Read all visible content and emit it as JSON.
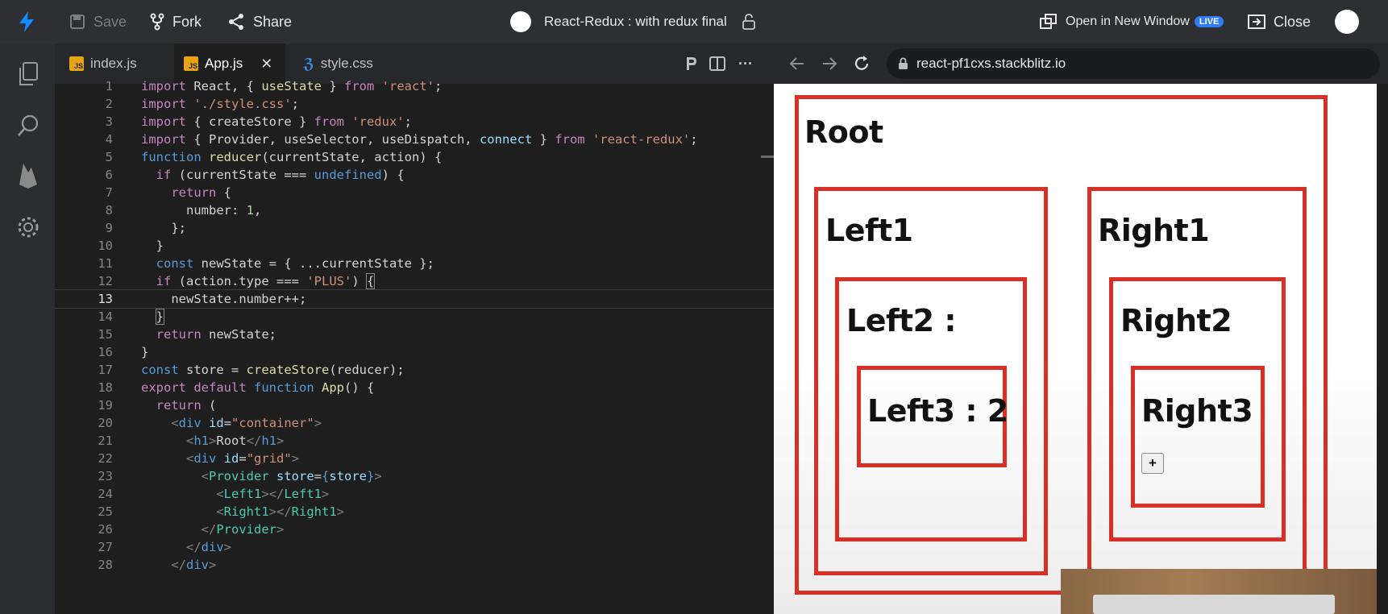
{
  "topbar": {
    "save_label": "Save",
    "fork_label": "Fork",
    "share_label": "Share",
    "project_title": "React-Redux : with redux final",
    "open_new_window_label": "Open in New Window",
    "live_badge": "LIVE",
    "close_label": "Close"
  },
  "activity_icons": [
    "files-icon",
    "search-icon",
    "firebase-icon",
    "settings-icon"
  ],
  "tabs": [
    {
      "label": "index.js",
      "type": "js"
    },
    {
      "label": "App.js",
      "type": "js",
      "active": true
    },
    {
      "label": "style.css",
      "type": "css"
    }
  ],
  "tab_icons": {
    "js": "JS"
  },
  "editor": {
    "current_line": 13,
    "line_numbers": [
      "1",
      "2",
      "3",
      "4",
      "5",
      "6",
      "7",
      "8",
      "9",
      "10",
      "11",
      "12",
      "13",
      "14",
      "15",
      "16",
      "17",
      "18",
      "19",
      "20",
      "21",
      "22",
      "23",
      "24",
      "25",
      "26",
      "27",
      "28"
    ]
  },
  "browser": {
    "url": "react-pf1cxs.stackblitz.io"
  },
  "preview": {
    "root_title": "Root",
    "left1_title": "Left1",
    "left2_title": "Left2 :",
    "left3_title": "Left3 : 2",
    "right1_title": "Right1",
    "right2_title": "Right2",
    "right3_title": "Right3",
    "plus_button": "+"
  },
  "colors": {
    "accent": "#2f7cf6",
    "box_border": "#d93025",
    "editor_bg": "#1e1e1e"
  }
}
